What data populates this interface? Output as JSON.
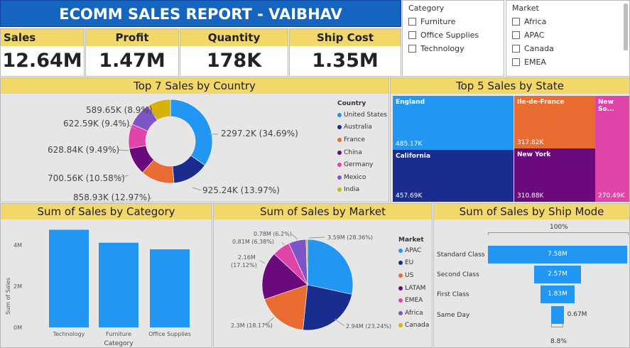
{
  "header": {
    "title": "ECOMM SALES REPORT - VAIBHAV"
  },
  "kpis": [
    {
      "label": "Sales",
      "value": "12.64M"
    },
    {
      "label": "Profit",
      "value": "1.47M"
    },
    {
      "label": "Quantity",
      "value": "178K"
    },
    {
      "label": "Ship Cost",
      "value": "1.35M"
    }
  ],
  "category_slicer": {
    "title": "Category",
    "items": [
      "Furniture",
      "Office Supplies",
      "Technology"
    ]
  },
  "market_slicer": {
    "title": "Market",
    "items": [
      "Africa",
      "APAC",
      "Canada",
      "EMEA"
    ]
  },
  "country_chart": {
    "title": "Top 7 Sales by Country",
    "legend_title": "Country",
    "labels": [
      "2297.2K (34.69%)",
      "925.24K (13.97%)",
      "858.93K (12.97%)",
      "700.56K (10.58%)",
      "628.84K (9.49%)",
      "622.59K (9.4%)",
      "589.65K (8.9%)"
    ],
    "legend": [
      "United States",
      "Australia",
      "France",
      "China",
      "Germany",
      "Mexico",
      "India"
    ]
  },
  "state_chart": {
    "title": "Top 5 Sales by State",
    "items": [
      {
        "name": "England",
        "value": "485.17K"
      },
      {
        "name": "Ile-de-France",
        "value": "317.82K"
      },
      {
        "name": "New So...",
        "value": "270.49K"
      },
      {
        "name": "California",
        "value": "457.69K"
      },
      {
        "name": "New York",
        "value": "310.88K"
      }
    ]
  },
  "category_chart": {
    "title": "Sum of Sales by Category",
    "ylabel": "Sum of Sales",
    "xlabel": "Category",
    "yticks": [
      "4M",
      "2M",
      "0M"
    ],
    "categories": [
      "Technology",
      "Furniture",
      "Office Supplies"
    ]
  },
  "market_chart": {
    "title": "Sum of Sales by Market",
    "legend_title": "Market",
    "legend": [
      "APAC",
      "EU",
      "US",
      "LATAM",
      "EMEA",
      "Africa",
      "Canada"
    ],
    "labels": {
      "apac": "3.59M (28.36%)",
      "eu": "2.94M (23.24%)",
      "us": "2.3M (18.17%)",
      "latam_a": "2.16M",
      "latam_b": "(17.12%)",
      "emea": "0.81M (6.38%)",
      "africa": "0.78M (6.2%)"
    }
  },
  "shipmode_chart": {
    "title": "Sum of Sales by Ship Mode",
    "top_pct": "100%",
    "bottom_pct": "8.8%",
    "rows": [
      {
        "label": "Standard Class",
        "value": "7.58M"
      },
      {
        "label": "Second Class",
        "value": "2.57M"
      },
      {
        "label": "First Class",
        "value": "1.83M"
      },
      {
        "label": "Same Day",
        "value": "0.67M"
      }
    ]
  },
  "chart_data": [
    {
      "type": "pie",
      "title": "Top 7 Sales by Country",
      "categories": [
        "United States",
        "Australia",
        "France",
        "China",
        "Germany",
        "Mexico",
        "India"
      ],
      "values": [
        2297.2,
        925.24,
        858.93,
        700.56,
        628.84,
        622.59,
        589.65
      ],
      "percentages": [
        34.69,
        13.97,
        12.97,
        10.58,
        9.49,
        9.4,
        8.9
      ],
      "colors": [
        "#2196f3",
        "#1a2d8f",
        "#e96d33",
        "#6a0a7d",
        "#df45a8",
        "#7e55c7",
        "#d8b10b"
      ]
    },
    {
      "type": "treemap",
      "title": "Top 5 Sales by State",
      "categories": [
        "England",
        "California",
        "Ile-de-France",
        "New York",
        "New So..."
      ],
      "values": [
        485.17,
        457.69,
        317.82,
        310.88,
        270.49
      ],
      "colors": [
        "#2196f3",
        "#1a2d8f",
        "#e96d33",
        "#6a0a7d",
        "#df45a8"
      ]
    },
    {
      "type": "bar",
      "title": "Sum of Sales by Category",
      "categories": [
        "Technology",
        "Furniture",
        "Office Supplies"
      ],
      "values": [
        4.74,
        4.11,
        3.79
      ],
      "ylim": [
        0,
        5.2
      ],
      "xlabel": "Category",
      "ylabel": "Sum of Sales",
      "color": "#2196f3"
    },
    {
      "type": "pie",
      "title": "Sum of Sales by Market",
      "categories": [
        "APAC",
        "EU",
        "US",
        "LATAM",
        "EMEA",
        "Africa",
        "Canada"
      ],
      "values": [
        3.59,
        2.94,
        2.3,
        2.16,
        0.81,
        0.78,
        0.07
      ],
      "percentages": [
        28.36,
        23.24,
        18.17,
        17.12,
        6.38,
        6.2,
        0.53
      ],
      "colors": [
        "#2196f3",
        "#1a2d8f",
        "#e96d33",
        "#6a0a7d",
        "#df45a8",
        "#7e55c7",
        "#d8b10b"
      ]
    },
    {
      "type": "funnel",
      "title": "Sum of Sales by Ship Mode",
      "categories": [
        "Standard Class",
        "Second Class",
        "First Class",
        "Same Day"
      ],
      "values": [
        7.58,
        2.57,
        1.83,
        0.67
      ],
      "color": "#2196f3"
    }
  ]
}
